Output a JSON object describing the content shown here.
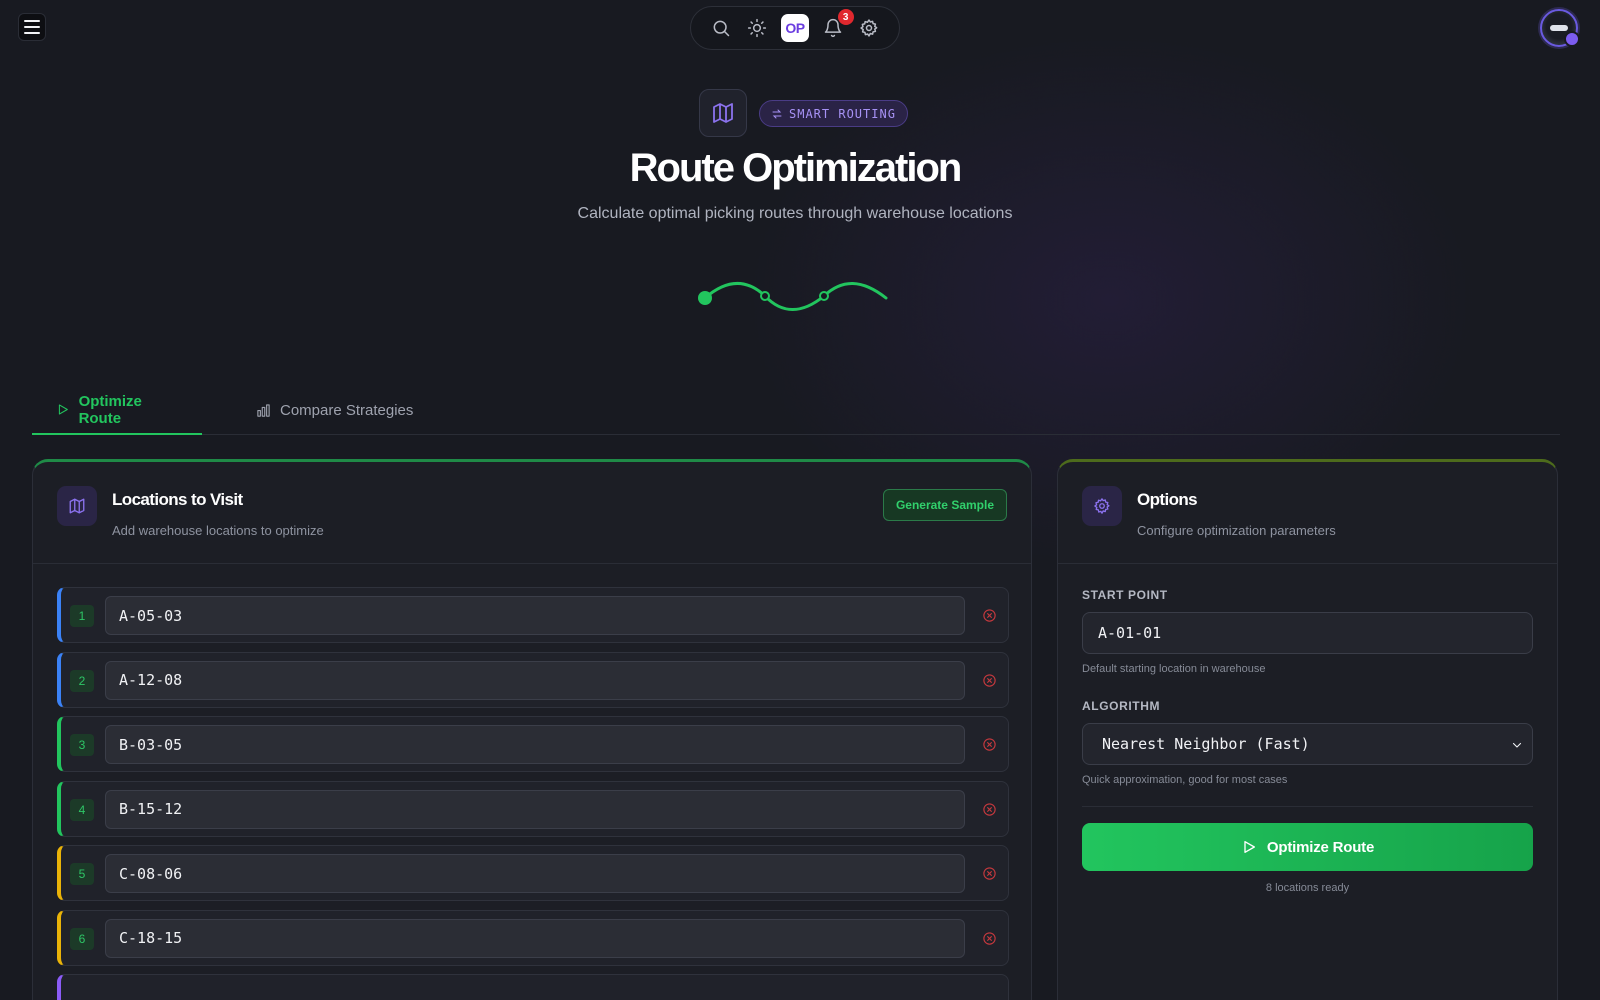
{
  "toolbar": {
    "logo_text": "OP",
    "notification_count": "3",
    "icons": [
      "search-icon",
      "sun-icon",
      "bell-icon",
      "gear-icon"
    ]
  },
  "hero": {
    "badge_label": "SMART ROUTING",
    "title": "Route Optimization",
    "subtitle": "Calculate optimal picking routes through warehouse locations"
  },
  "tabs": [
    {
      "label": "Optimize Route",
      "active": true
    },
    {
      "label": "Compare Strategies",
      "active": false
    }
  ],
  "locations_panel": {
    "title": "Locations to Visit",
    "subtitle": "Add warehouse locations to optimize",
    "generate_label": "Generate Sample",
    "rows": [
      {
        "num": "1",
        "value": "A-05-03",
        "accent": "#3b82f6"
      },
      {
        "num": "2",
        "value": "A-12-08",
        "accent": "#3b82f6"
      },
      {
        "num": "3",
        "value": "B-03-05",
        "accent": "#22c55e"
      },
      {
        "num": "4",
        "value": "B-15-12",
        "accent": "#22c55e"
      },
      {
        "num": "5",
        "value": "C-08-06",
        "accent": "#eab308"
      },
      {
        "num": "6",
        "value": "C-18-15",
        "accent": "#eab308"
      }
    ]
  },
  "options_panel": {
    "title": "Options",
    "subtitle": "Configure optimization parameters",
    "start_label": "START POINT",
    "start_value": "A-01-01",
    "start_help": "Default starting location in warehouse",
    "algorithm_label": "ALGORITHM",
    "algorithm_value": "Nearest Neighbor (Fast)",
    "algorithm_help": "Quick approximation, good for most cases",
    "button_label": "Optimize Route",
    "ready_text": "8 locations ready"
  },
  "colors": {
    "accent_green": "#22c55e",
    "accent_purple": "#8b72ee",
    "background": "#181a21"
  }
}
